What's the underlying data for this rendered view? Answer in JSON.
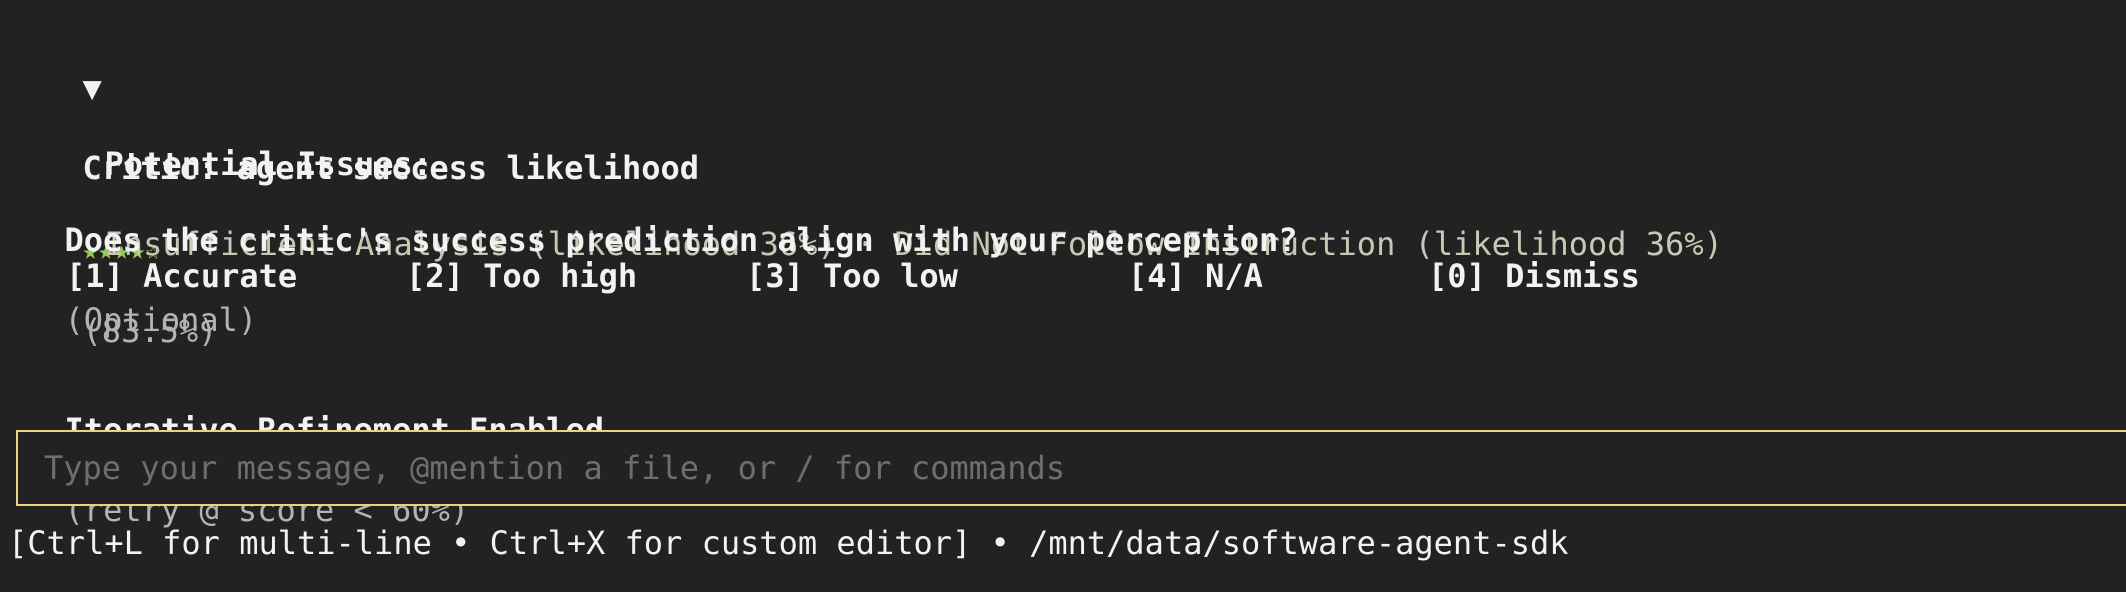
{
  "critic": {
    "toggle_icon": "▼",
    "title": "Critic: agent success likelihood",
    "stars": "★★★★☆",
    "stars_value": 4,
    "stars_max": 5,
    "score": "(83.5%)"
  },
  "issues": {
    "label": "Potential Issues:",
    "text": "Insufficient Analysis (likelihood 36%) · Did Not Follow Instruction (likelihood 36%)"
  },
  "question": {
    "text": "Does the critic's success prediction align with your perception?",
    "optional": "(Optional)"
  },
  "options": [
    {
      "label": "[1] Accurate"
    },
    {
      "label": "[2] Too high"
    },
    {
      "label": "[3] Too low"
    },
    {
      "label": "[4] N/A"
    },
    {
      "label": "[0] Dismiss"
    }
  ],
  "refinement": {
    "label": "Iterative Refinement Enabled",
    "detail": "(retry @ score < 60%)"
  },
  "input": {
    "placeholder": "Type your message, @mention a file, or / for commands",
    "value": ""
  },
  "footer": {
    "text": "[Ctrl+L for multi-line • Ctrl+X for custom editor] • /mnt/data/software-agent-sdk"
  },
  "colors": {
    "background": "#222222",
    "stars": "#8fd14f",
    "input_border": "#e8d27a",
    "muted_text": "#b3b3b3"
  }
}
